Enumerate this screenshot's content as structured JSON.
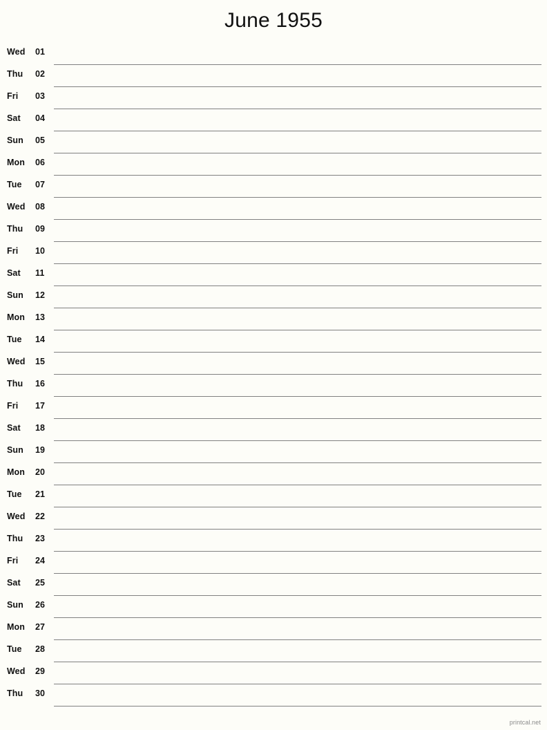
{
  "document": {
    "title": "June 1955",
    "month": "June",
    "year": "1955",
    "background_color": "#fdfdf8",
    "line_color": "#808080",
    "text_color": "#111111"
  },
  "footer": {
    "credit": "printcal.net",
    "color": "#8a8a8a"
  },
  "calendar": {
    "type": "single-column-list",
    "days": [
      {
        "weekday": "Wed",
        "number": "01"
      },
      {
        "weekday": "Thu",
        "number": "02"
      },
      {
        "weekday": "Fri",
        "number": "03"
      },
      {
        "weekday": "Sat",
        "number": "04"
      },
      {
        "weekday": "Sun",
        "number": "05"
      },
      {
        "weekday": "Mon",
        "number": "06"
      },
      {
        "weekday": "Tue",
        "number": "07"
      },
      {
        "weekday": "Wed",
        "number": "08"
      },
      {
        "weekday": "Thu",
        "number": "09"
      },
      {
        "weekday": "Fri",
        "number": "10"
      },
      {
        "weekday": "Sat",
        "number": "11"
      },
      {
        "weekday": "Sun",
        "number": "12"
      },
      {
        "weekday": "Mon",
        "number": "13"
      },
      {
        "weekday": "Tue",
        "number": "14"
      },
      {
        "weekday": "Wed",
        "number": "15"
      },
      {
        "weekday": "Thu",
        "number": "16"
      },
      {
        "weekday": "Fri",
        "number": "17"
      },
      {
        "weekday": "Sat",
        "number": "18"
      },
      {
        "weekday": "Sun",
        "number": "19"
      },
      {
        "weekday": "Mon",
        "number": "20"
      },
      {
        "weekday": "Tue",
        "number": "21"
      },
      {
        "weekday": "Wed",
        "number": "22"
      },
      {
        "weekday": "Thu",
        "number": "23"
      },
      {
        "weekday": "Fri",
        "number": "24"
      },
      {
        "weekday": "Sat",
        "number": "25"
      },
      {
        "weekday": "Sun",
        "number": "26"
      },
      {
        "weekday": "Mon",
        "number": "27"
      },
      {
        "weekday": "Tue",
        "number": "28"
      },
      {
        "weekday": "Wed",
        "number": "29"
      },
      {
        "weekday": "Thu",
        "number": "30"
      }
    ]
  }
}
